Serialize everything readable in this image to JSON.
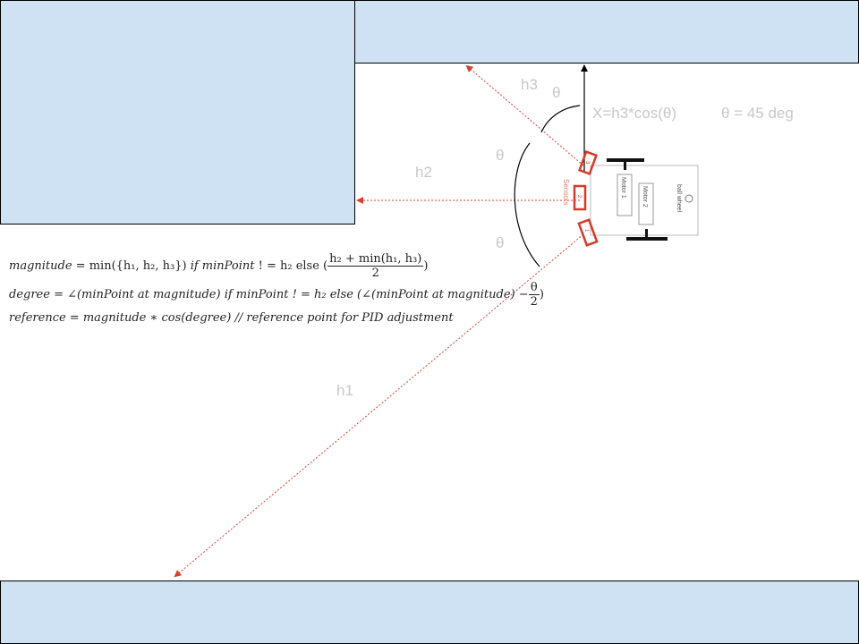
{
  "labels": {
    "h1": "h1",
    "h2": "h2",
    "h3": "h3",
    "theta_top": "θ",
    "theta_mid": "θ",
    "theta_bot": "θ",
    "x_formula": "X=h3*cos(θ)",
    "theta_value": "θ = 45 deg"
  },
  "robot": {
    "motor1": "Motor 1",
    "motor2": "Motor 2",
    "ball_wheel": "ball wheel",
    "sensor_label": "Sensors",
    "sensor_ids": [
      "1",
      "2",
      "3"
    ]
  },
  "formulas": {
    "line1_lhs": "magnitude",
    "line1_min": "min({h₁, h₂, h₃})",
    "line1_if": "if minPoint",
    "line1_neq": "! = h₂ else (",
    "line1_num": "h₂ + min(h₁, h₃)",
    "line1_den": "2",
    "line1_close": ")",
    "line2_lhs": "degree = ∠(minPoint at magnitude) if  minPoint",
    "line2_neq": "! = h₂ else (∠(minPoint at magnitude) −",
    "line2_num": "θ",
    "line2_den": "2",
    "line2_close": ")",
    "line3": "reference = magnitude ∗ cos(degree) // reference point for PID adjustment"
  },
  "colors": {
    "wall_fill": "#cfe2f3",
    "ray": "#d9412b",
    "sensor": "#d63a2a",
    "label": "#c8c8c8"
  }
}
